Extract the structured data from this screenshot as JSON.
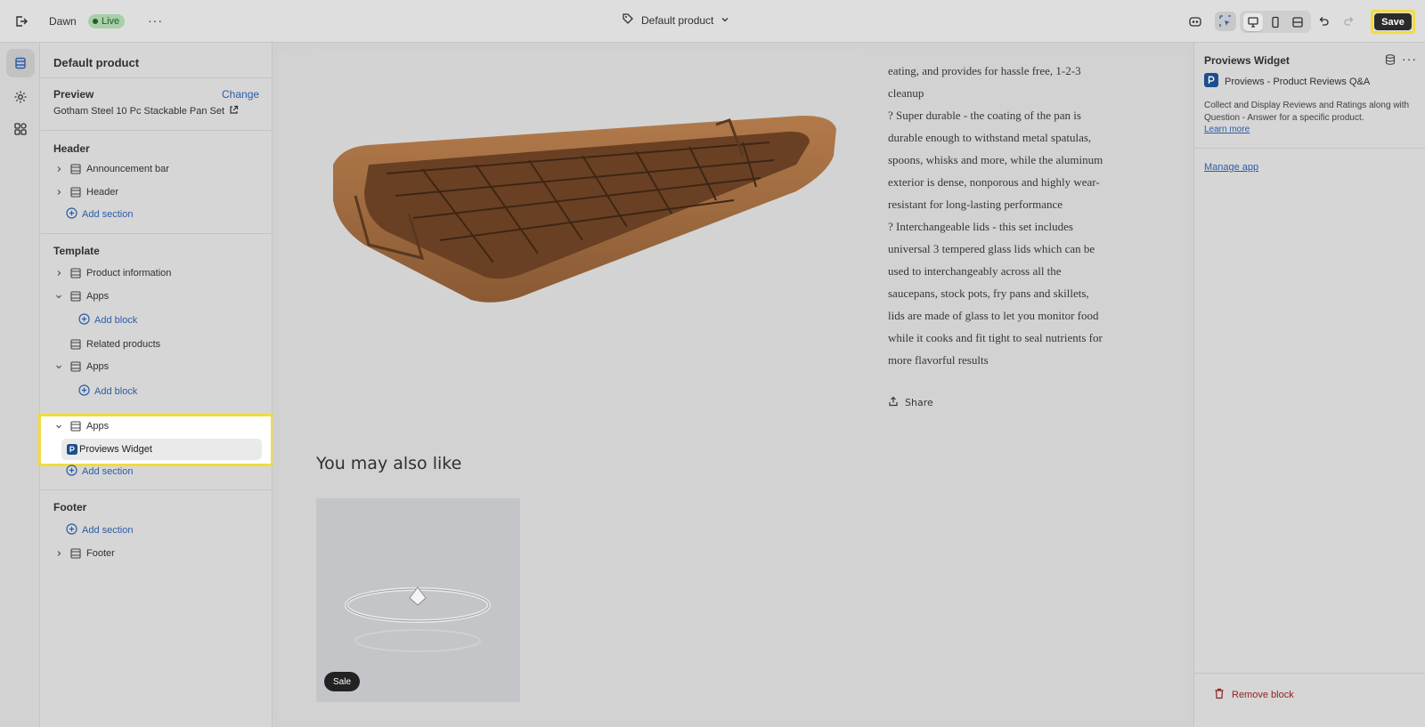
{
  "topbar": {
    "theme_name": "Dawn",
    "live_badge": "Live",
    "more_label": "···",
    "template_selector": "Default product",
    "save_label": "Save"
  },
  "sidebar": {
    "title": "Default product",
    "preview": {
      "label": "Preview",
      "change_label": "Change",
      "product": "Gotham Steel 10 Pc Stackable Pan Set"
    },
    "header_group": {
      "heading": "Header",
      "items": [
        "Announcement bar",
        "Header"
      ],
      "add_section": "Add section"
    },
    "template_group": {
      "heading": "Template",
      "items": [
        "Product information",
        "Apps",
        "Related products",
        "Apps",
        "Apps"
      ],
      "add_block": "Add block",
      "selected_block": "Proviews Widget",
      "add_section": "Add section"
    },
    "footer_group": {
      "heading": "Footer",
      "add_section": "Add section",
      "items": [
        "Footer"
      ]
    }
  },
  "canvas": {
    "description_lines": [
      "eating, and provides for hassle free, 1-2-3",
      "cleanup",
      "? Super durable - the coating of the pan is",
      "durable enough to withstand metal spatulas,",
      "spoons, whisks and more, while the aluminum",
      "exterior is dense, nonporous and highly wear-",
      "resistant for long-lasting performance",
      "? Interchangeable lids - this set includes",
      "universal 3 tempered glass lids which can be",
      "used to interchangeably across all the",
      "saucepans, stock pots, fry pans and skillets,",
      "lids are made of glass to let you monitor food",
      "while it cooks and fit tight to seal nutrients for",
      "more flavorful results"
    ],
    "share_label": "Share",
    "also_like_heading": "You may also like",
    "sale_badge": "Sale"
  },
  "right_panel": {
    "title": "Proviews Widget",
    "app_name": "Proviews - Product Reviews Q&A",
    "description": "Collect and Display Reviews and Ratings along with Question - Answer for a specific product.",
    "learn_more": "Learn more",
    "manage_app": "Manage app",
    "remove_block": "Remove block"
  },
  "colors": {
    "highlight": "#f2dc3c",
    "link": "#2b5ca8",
    "live_badge_bg": "#a8cfa8",
    "danger": "#8e1f1f"
  },
  "icons": [
    "exit-icon",
    "tag-icon",
    "chevron-down-icon",
    "inspect-icon",
    "selector-icon",
    "desktop-icon",
    "mobile-icon",
    "fullwidth-icon",
    "undo-icon",
    "redo-icon",
    "sections-icon",
    "settings-icon",
    "apps-icon",
    "section-icon",
    "plus-circle-icon",
    "external-link-icon",
    "share-icon",
    "database-icon",
    "trash-icon"
  ]
}
